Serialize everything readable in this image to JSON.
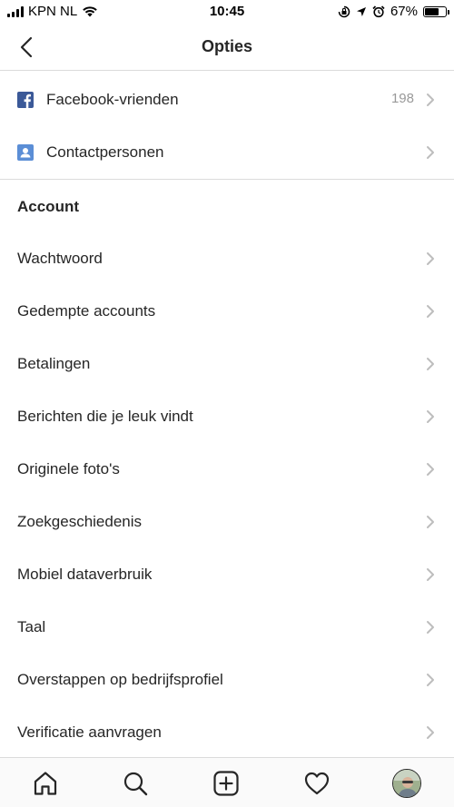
{
  "status_bar": {
    "carrier": "KPN NL",
    "time": "10:45",
    "battery_percent": "67%",
    "battery_level": 0.67
  },
  "header": {
    "title": "Opties",
    "back_icon": "chevron-left-icon"
  },
  "connections": [
    {
      "label": "Facebook-vrienden",
      "icon": "facebook-icon",
      "icon_color": "#3b5998",
      "count": "198"
    },
    {
      "label": "Contactpersonen",
      "icon": "contacts-icon",
      "icon_color": "#5b8ed6"
    }
  ],
  "account": {
    "title": "Account",
    "items": [
      "Wachtwoord",
      "Gedempte accounts",
      "Betalingen",
      "Berichten die je leuk vindt",
      "Originele foto's",
      "Zoekgeschiedenis",
      "Mobiel dataverbruik",
      "Taal",
      "Overstappen op bedrijfsprofiel",
      "Verificatie aanvragen"
    ]
  },
  "tab_bar": {
    "tabs": [
      "home-icon",
      "search-icon",
      "add-post-icon",
      "activity-heart-icon",
      "profile-avatar"
    ]
  },
  "colors": {
    "text": "#262626",
    "secondary_text": "#999999",
    "divider": "#dbdbdb",
    "facebook": "#3b5998"
  }
}
